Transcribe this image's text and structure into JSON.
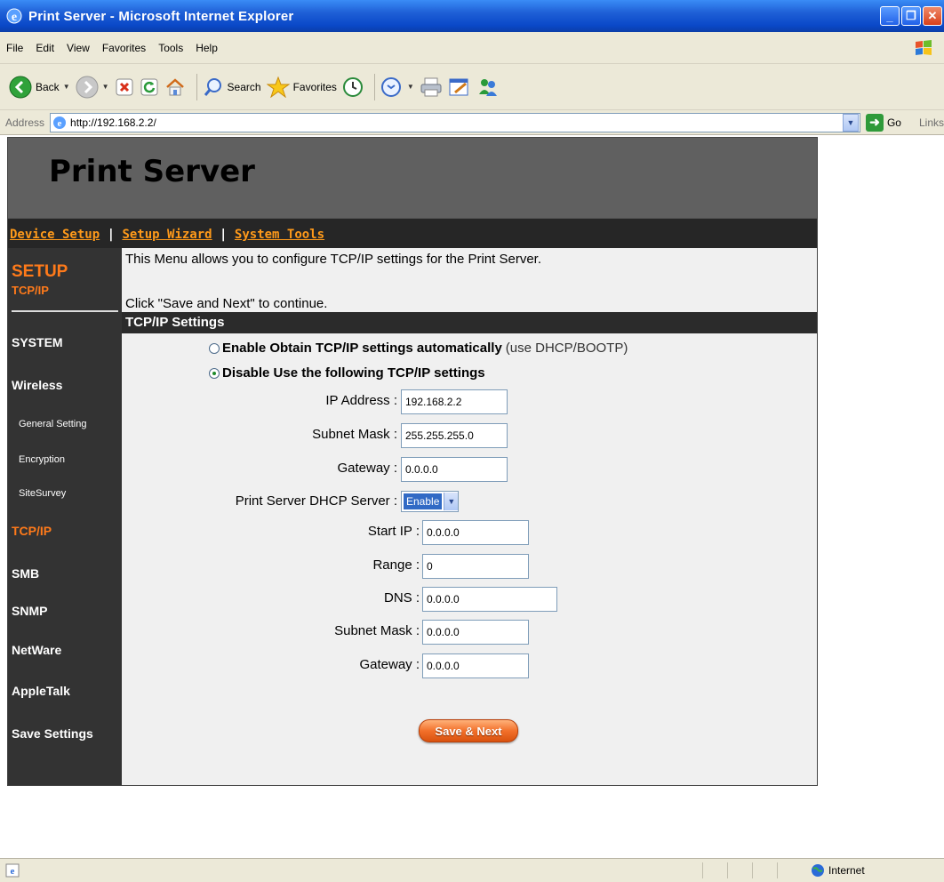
{
  "window": {
    "title": "Print Server - Microsoft Internet Explorer"
  },
  "menubar": {
    "items": [
      "File",
      "Edit",
      "View",
      "Favorites",
      "Tools",
      "Help"
    ]
  },
  "toolbar": {
    "back_label": "Back",
    "search_label": "Search",
    "favorites_label": "Favorites"
  },
  "addressbar": {
    "label": "Address",
    "url": "http://192.168.2.2/",
    "go_label": "Go",
    "links_label": "Links"
  },
  "page": {
    "title": "Print Server",
    "nav": {
      "device_setup": "Device Setup",
      "sep1": " | ",
      "setup_wizard": "Setup Wizard",
      "sep2": " | ",
      "system_tools": "System Tools"
    },
    "sidebar": {
      "setup_title": "SETUP",
      "setup_sub": "TCP/IP",
      "items": [
        "SYSTEM",
        "Wireless",
        "General Setting",
        "Encryption",
        "SiteSurvey",
        "TCP/IP",
        "SMB",
        "SNMP",
        "NetWare",
        "AppleTalk",
        "Save Settings"
      ]
    },
    "intro": "This Menu allows you to configure TCP/IP settings for the Print Server.",
    "intro2": "Click \"Save and Next\" to continue.",
    "section_title": "TCP/IP Settings",
    "radio_auto": {
      "label": "Enable Obtain TCP/IP settings automatically",
      "hint": "(use DHCP/BOOTP)",
      "checked": false
    },
    "radio_manual": {
      "label": "Disable Use the following TCP/IP settings",
      "checked": true
    },
    "fields": {
      "ip_label": "IP Address :",
      "ip_value": "192.168.2.2",
      "mask_label": "Subnet Mask :",
      "mask_value": "255.255.255.0",
      "gateway_label": "Gateway :",
      "gateway_value": "0.0.0.0",
      "dhcp_label": "Print Server DHCP Server :",
      "dhcp_value": "Enable",
      "start_ip_label": "Start IP :",
      "start_ip_value": "0.0.0.0",
      "range_label": "Range :",
      "range_value": "0",
      "dns_label": "DNS :",
      "dns_value": "0.0.0.0",
      "dhcp_mask_label": "Subnet Mask :",
      "dhcp_mask_value": "0.0.0.0",
      "dhcp_gateway_label": "Gateway :",
      "dhcp_gateway_value": "0.0.0.0"
    },
    "save_button": "Save & Next"
  },
  "statusbar": {
    "zone": "Internet"
  }
}
